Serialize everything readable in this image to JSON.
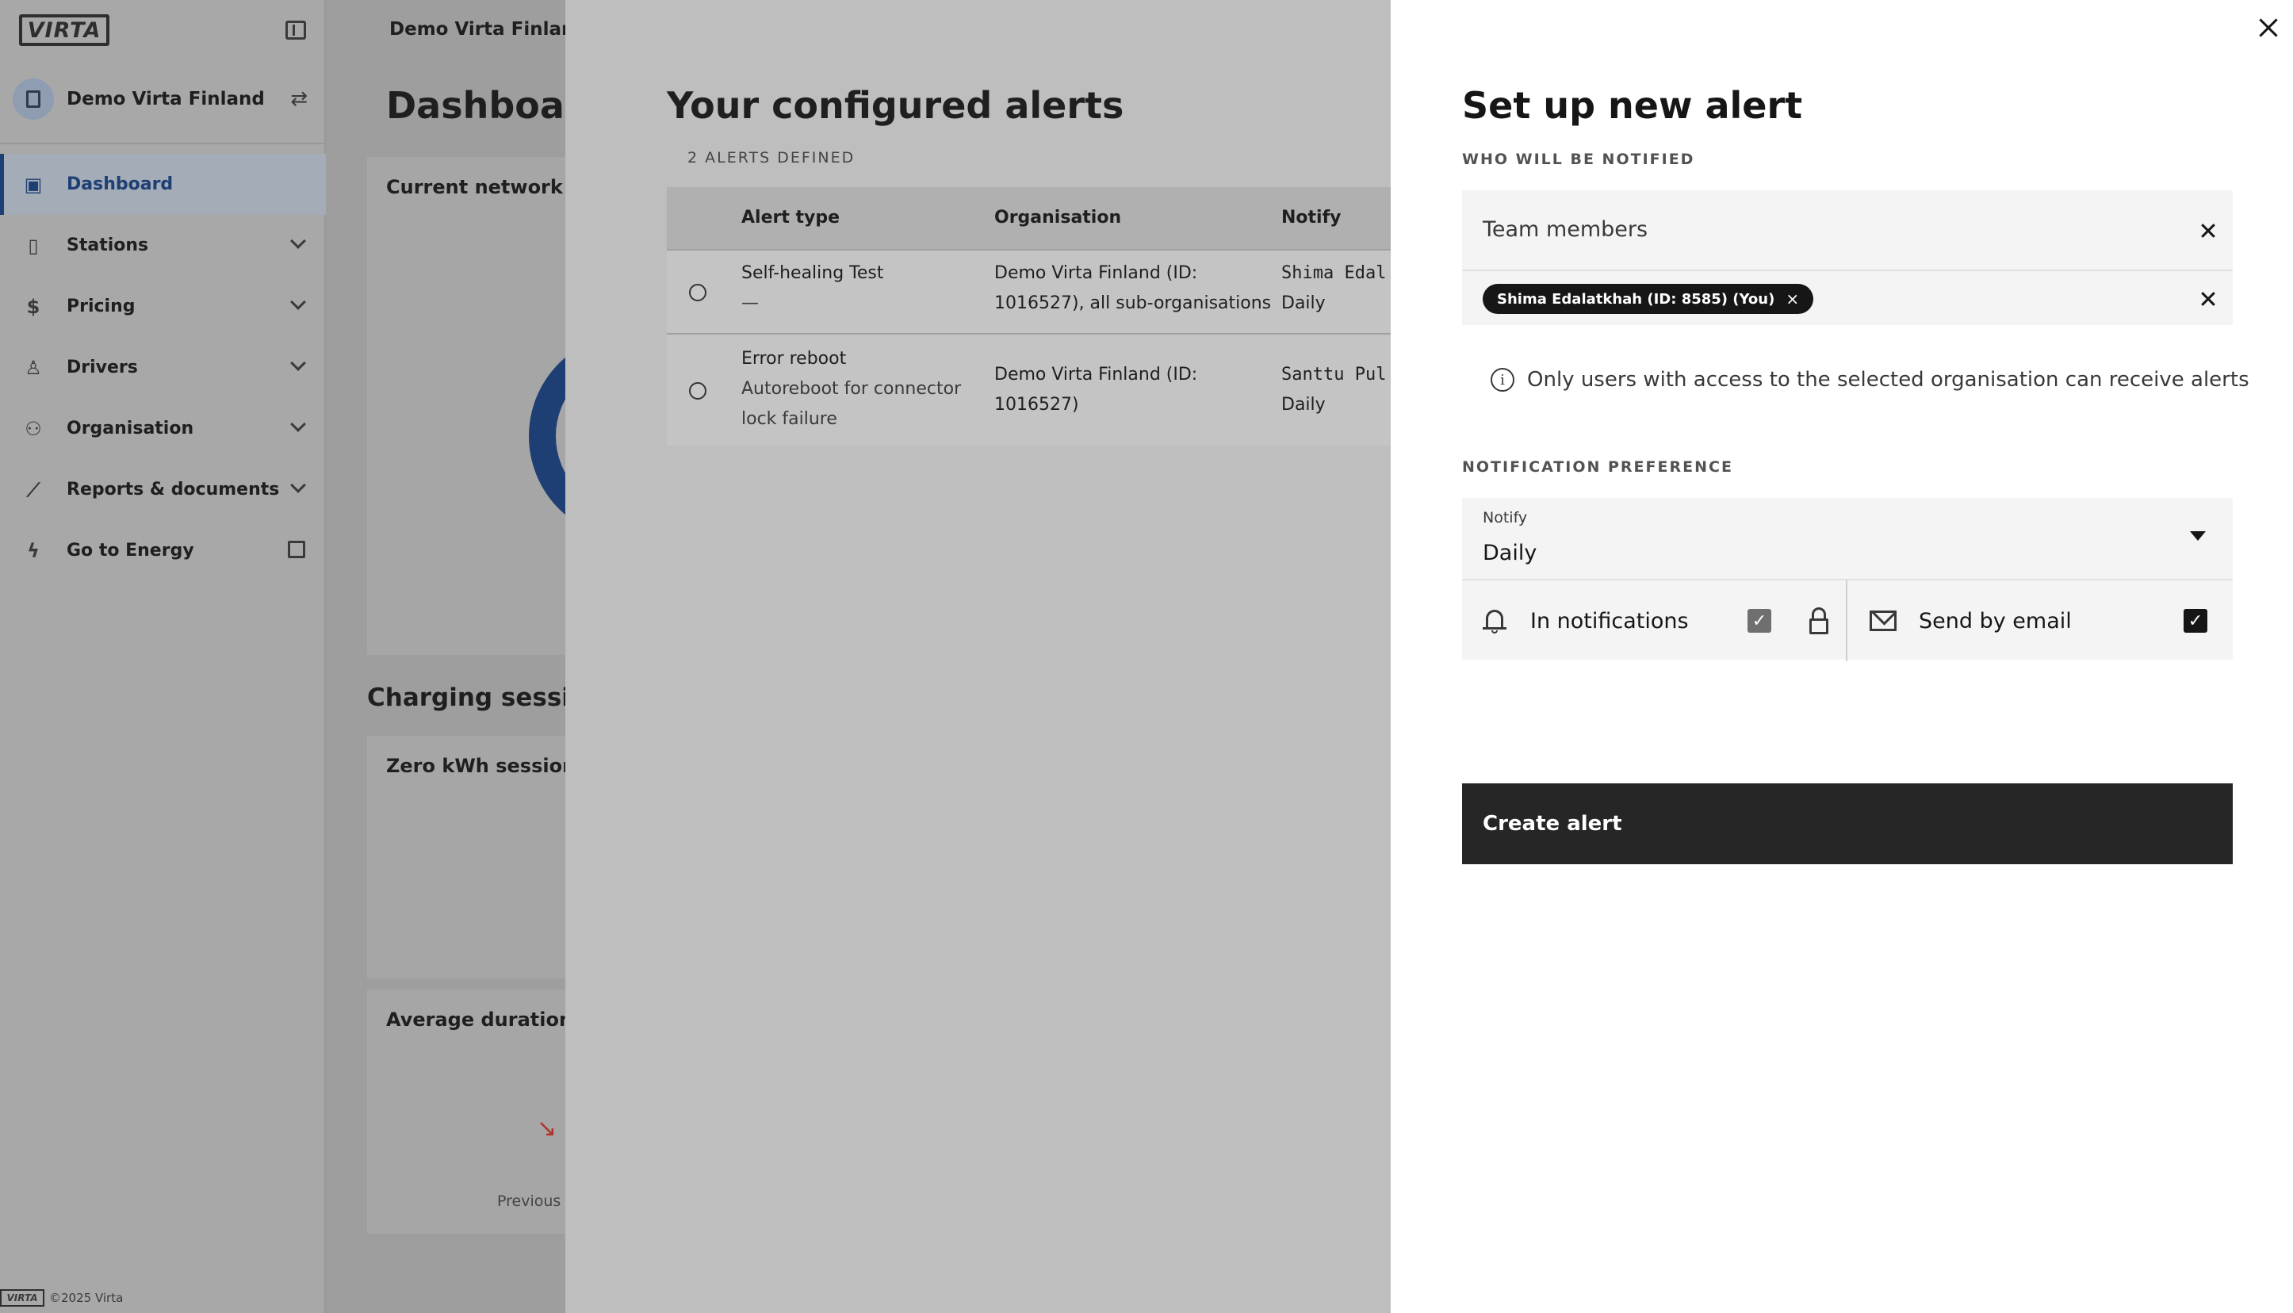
{
  "sidebar": {
    "logo_text": "VIRTA",
    "org_name": "Demo Virta Finland",
    "items": [
      {
        "label": "Dashboard",
        "icon": "dashboard-icon"
      },
      {
        "label": "Stations",
        "icon": "station-icon"
      },
      {
        "label": "Pricing",
        "icon": "dollar-icon"
      },
      {
        "label": "Drivers",
        "icon": "driver-icon"
      },
      {
        "label": "Organisation",
        "icon": "organisation-icon"
      },
      {
        "label": "Reports & documents",
        "icon": "chart-icon"
      },
      {
        "label": "Go to Energy",
        "icon": "bolt-icon"
      }
    ],
    "footer_logo": "VIRTA",
    "footer": "©2025 Virta"
  },
  "dashboard": {
    "org_header": "Demo Virta Finland (I",
    "title": "Dashboard",
    "card_network": "Current network st",
    "section_charging": "Charging session",
    "card_zero": "Zero kWh sessions",
    "card_avg": "Average duration",
    "previous": "Previous"
  },
  "alerts": {
    "title": "Your configured alerts",
    "count": "2 ALERTS DEFINED",
    "columns": [
      "Alert type",
      "Organisation",
      "Notify"
    ],
    "rows": [
      {
        "type": "Self-healing Test",
        "type_sub": "—",
        "org_line1": "Demo Virta Finland (ID:",
        "org_line2": "1016527), all sub-organisations",
        "notify_user": "Shima Edal",
        "notify_freq": "Daily"
      },
      {
        "type": "Error reboot",
        "type_sub1": "Autoreboot for connector",
        "type_sub2": "lock failure",
        "org_line1": "Demo Virta Finland (ID:",
        "org_line2": "1016527)",
        "notify_user": "Santtu Pul",
        "notify_freq": "Daily"
      }
    ]
  },
  "drawer": {
    "title": "Set up new alert",
    "who_label": "WHO WILL BE NOTIFIED",
    "team_placeholder": "Team members",
    "tag": "Shima Edalatkhah (ID: 8585) (You)",
    "tag_remove": "×",
    "info": "Only users with access to the selected organisation can receive alerts",
    "pref_label": "NOTIFICATION PREFERENCE",
    "notify_label": "Notify",
    "notify_value": "Daily",
    "in_notifications": "In notifications",
    "in_notifications_checked": true,
    "send_email": "Send by email",
    "send_email_checked": true,
    "create_button": "Create alert"
  }
}
